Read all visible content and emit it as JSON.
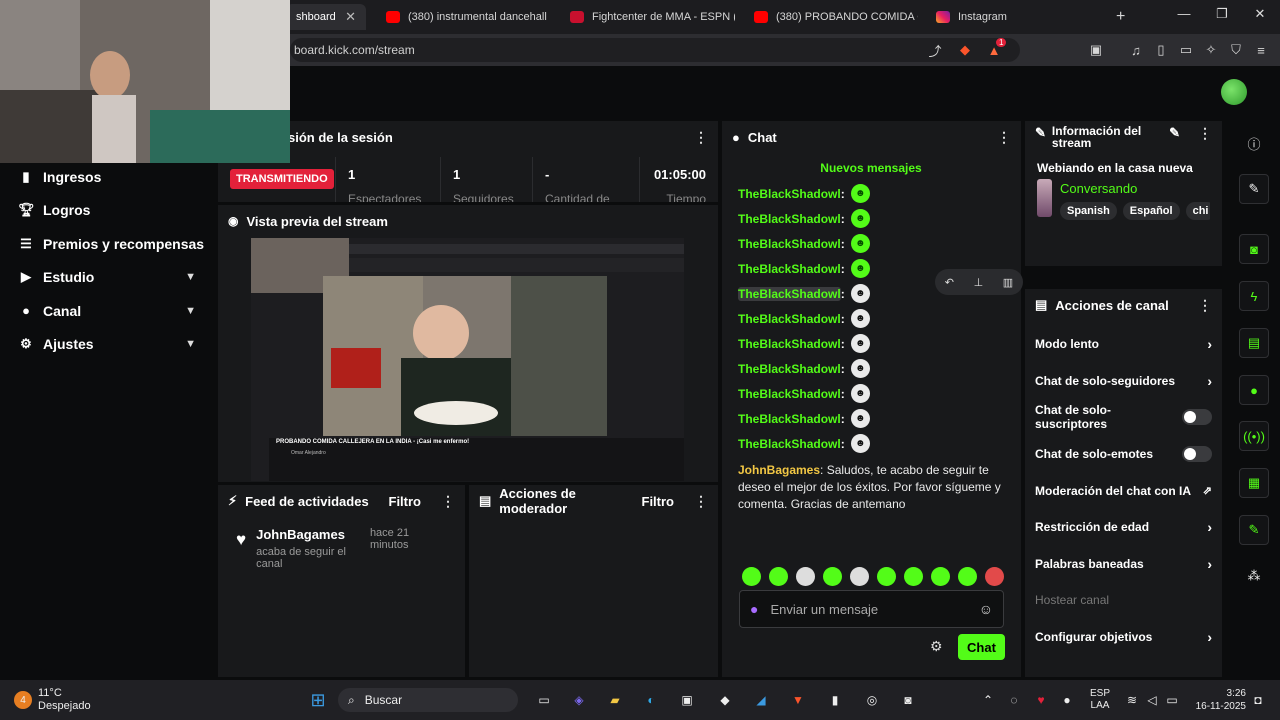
{
  "browser": {
    "tabs": [
      {
        "label": "shboard",
        "close": "✕"
      },
      {
        "label": "(380) instrumental dancehall - Yo"
      },
      {
        "label": "Fightcenter de MMA - ESPN (CL"
      },
      {
        "label": "(380) PROBANDO COMIDA CALL"
      },
      {
        "label": "Instagram"
      }
    ],
    "new_tab": "+",
    "url": "board.kick.com/stream",
    "badge_count": "1"
  },
  "sidebar": {
    "items": [
      {
        "label": "Ingresos",
        "icon": "chart-icon"
      },
      {
        "label": "Logros",
        "icon": "trophy-icon"
      },
      {
        "label": "Premios y recompensas",
        "icon": "list-icon"
      },
      {
        "label": "Estudio",
        "icon": "camera-icon",
        "expandable": true
      },
      {
        "label": "Canal",
        "icon": "user-icon",
        "expandable": true
      },
      {
        "label": "Ajustes",
        "icon": "gear-icon",
        "expandable": true
      }
    ]
  },
  "session": {
    "title": "sión de la sesión",
    "status": "TRANSMITIENDO",
    "stats": [
      {
        "value": "1",
        "label": "Espectadores"
      },
      {
        "value": "1",
        "label": "Seguidores"
      },
      {
        "value": "-",
        "label": "Cantidad de"
      },
      {
        "value": "01:05:00",
        "label": "Tiempo"
      }
    ]
  },
  "preview": {
    "title": "Vista previa del stream",
    "video_caption": "PROBANDO COMIDA CALLEJERA EN LA INDIA - ¡Casi me enfermo!",
    "video_channel": "Omar Alejandro"
  },
  "feed": {
    "title": "Feed de actividades",
    "filter": "Filtro",
    "items": [
      {
        "name": "JohnBagames",
        "action": "acaba de seguir el canal",
        "time": "hace 21 minutos"
      }
    ]
  },
  "moderator": {
    "title": "Acciones de moderador",
    "filter": "Filtro"
  },
  "chat": {
    "title": "Chat",
    "new_messages": "Nuevos mensajes",
    "messages": [
      {
        "user": "TheBlackShadowl",
        "emote": "green"
      },
      {
        "user": "TheBlackShadowl",
        "emote": "green"
      },
      {
        "user": "TheBlackShadowl",
        "emote": "green"
      },
      {
        "user": "TheBlackShadowl",
        "emote": "green"
      },
      {
        "user": "TheBlackShadowl",
        "emote": "white"
      },
      {
        "user": "TheBlackShadowl",
        "emote": "white"
      },
      {
        "user": "TheBlackShadowl",
        "emote": "white"
      },
      {
        "user": "TheBlackShadowl",
        "emote": "white"
      },
      {
        "user": "TheBlackShadowl",
        "emote": "white"
      },
      {
        "user": "TheBlackShadowl",
        "emote": "white"
      },
      {
        "user": "TheBlackShadowl",
        "emote": "white"
      }
    ],
    "long_message": {
      "user": "JohnBagames",
      "text": "Saludos, te acabo de seguir te deseo el mejor de los éxitos. Por favor sígueme y comenta. Gracias de antemano"
    },
    "placeholder": "Enviar un mensaje",
    "send": "Chat"
  },
  "stream_info": {
    "title": "Información del stream",
    "stream_title": "Webiando en la casa nueva",
    "category": "Conversando",
    "tags": [
      "Spanish",
      "Español",
      "chi"
    ]
  },
  "channel_actions": {
    "title": "Acciones de canal",
    "items": [
      {
        "label": "Modo lento",
        "control": "arrow"
      },
      {
        "label": "Chat de solo-seguidores",
        "control": "arrow"
      },
      {
        "label": "Chat de solo-suscriptores",
        "control": "toggle"
      },
      {
        "label": "Chat de solo-emotes",
        "control": "toggle"
      },
      {
        "label": "Moderación del chat con IA",
        "control": "external"
      },
      {
        "label": "Restricción de edad",
        "control": "arrow"
      },
      {
        "label": "Palabras baneadas",
        "control": "arrow"
      },
      {
        "label": "Hostear canal",
        "control": "disabled"
      },
      {
        "label": "Configurar objetivos",
        "control": "arrow"
      }
    ]
  },
  "taskbar": {
    "weather_temp": "11°C",
    "weather_desc": "Despejado",
    "weather_badge": "4",
    "search": "Buscar",
    "lang_1": "ESP",
    "lang_2": "LAA",
    "time": "3:26",
    "date": "16-11-2025"
  },
  "colors": {
    "kick_green": "#53fc18",
    "live_red": "#e3213a",
    "panel_bg": "#18191b",
    "page_bg": "#0b0c0d"
  }
}
